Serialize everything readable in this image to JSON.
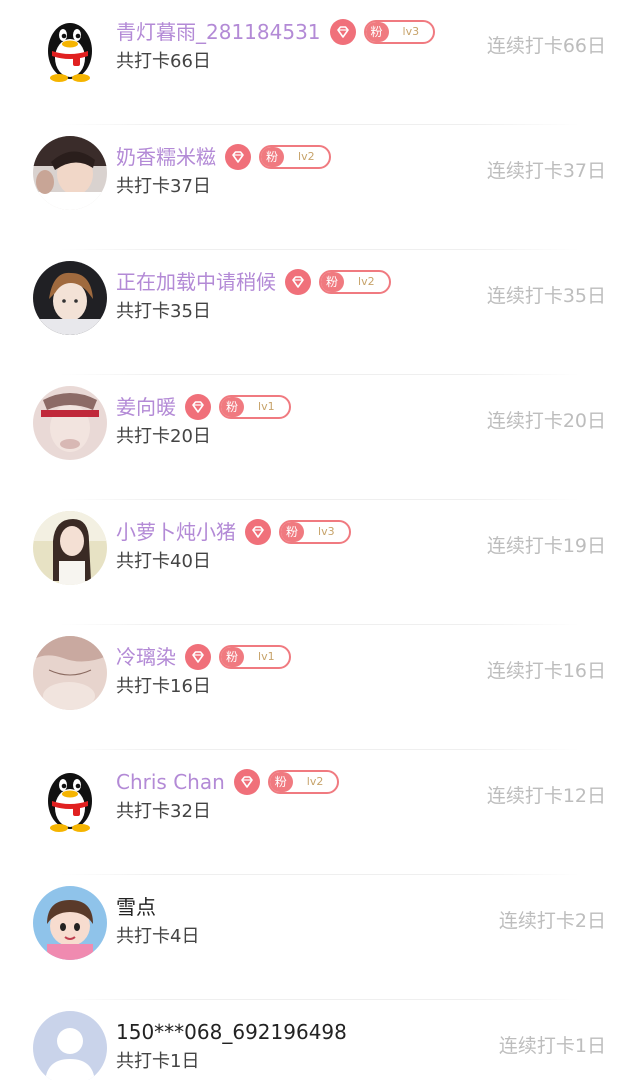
{
  "colors": {
    "name_color": "#b38ad6",
    "plain_name_color": "#222222",
    "badge_color": "#f07a80",
    "level_color": "#c7a36a",
    "streak_color": "#bdbdbd"
  },
  "fan_label": "粉",
  "rows": [
    {
      "name": "青灯暮雨_281184531",
      "styled": true,
      "level": "lv3",
      "total": "共打卡66日",
      "streak": "连续打卡66日",
      "avatar": "qq-penguin-avatar"
    },
    {
      "name": "奶香糯米糍",
      "styled": true,
      "level": "lv2",
      "total": "共打卡37日",
      "streak": "连续打卡37日",
      "avatar": "photo-avatar"
    },
    {
      "name": "正在加载中请稍候",
      "styled": true,
      "level": "lv2",
      "total": "共打卡35日",
      "streak": "连续打卡35日",
      "avatar": "anime-avatar"
    },
    {
      "name": "姜向暖",
      "styled": true,
      "level": "lv1",
      "total": "共打卡20日",
      "streak": "连续打卡20日",
      "avatar": "photo-avatar"
    },
    {
      "name": "小萝卜炖小猪",
      "styled": true,
      "level": "lv3",
      "total": "共打卡40日",
      "streak": "连续打卡19日",
      "avatar": "photo-avatar"
    },
    {
      "name": "冷璃染",
      "styled": true,
      "level": "lv1",
      "total": "共打卡16日",
      "streak": "连续打卡16日",
      "avatar": "photo-avatar"
    },
    {
      "name": "Chris Chan",
      "styled": true,
      "level": "lv2",
      "total": "共打卡32日",
      "streak": "连续打卡12日",
      "avatar": "qq-penguin-avatar"
    },
    {
      "name": "雪点",
      "styled": false,
      "total": "共打卡4日",
      "streak": "连续打卡2日",
      "avatar": "cartoon-avatar"
    },
    {
      "name": "150***068_692196498",
      "styled": false,
      "total": "共打卡1日",
      "streak": "连续打卡1日",
      "avatar": "default-avatar"
    }
  ]
}
